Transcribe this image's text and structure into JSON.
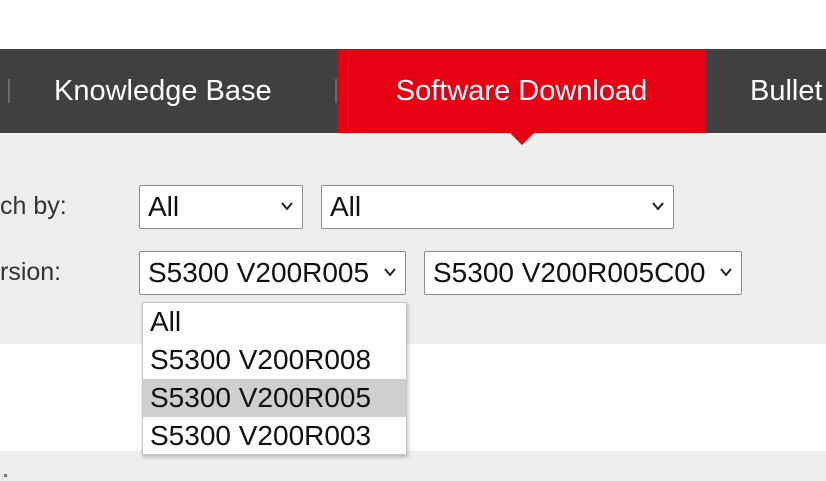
{
  "nav": {
    "tabs": [
      {
        "label": "Knowledge Base",
        "active": false
      },
      {
        "label": "Software Download",
        "active": true
      },
      {
        "label": "Bullet",
        "active": false
      }
    ]
  },
  "filters": {
    "search_label": "ch by:",
    "search_primary_value": "All",
    "search_secondary_value": "All",
    "version_label": "rsion:",
    "version_primary_value": "S5300 V200R005",
    "version_secondary_value": "S5300 V200R005C00"
  },
  "dropdown": {
    "options": [
      {
        "label": "All",
        "selected": false
      },
      {
        "label": "S5300 V200R008",
        "selected": false
      },
      {
        "label": "S5300 V200R005",
        "selected": true
      },
      {
        "label": "S5300 V200R003",
        "selected": false
      }
    ]
  },
  "colors": {
    "nav_bg": "#404040",
    "accent": "#e60012",
    "panel_bg": "#eeeeee",
    "option_highlight": "#cfcfcf"
  },
  "icons": {
    "select_arrow": "chevron-down-icon"
  }
}
